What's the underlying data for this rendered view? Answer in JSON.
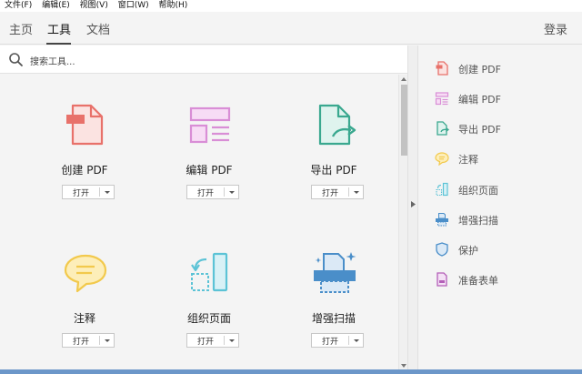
{
  "menu": [
    "文件(F)",
    "编辑(E)",
    "视图(V)",
    "窗口(W)",
    "帮助(H)"
  ],
  "tabs": [
    "主页",
    "工具",
    "文档"
  ],
  "login": "登录",
  "search": {
    "placeholder": "搜索工具..."
  },
  "tools": [
    {
      "name": "创建 PDF",
      "open": "打开"
    },
    {
      "name": "编辑 PDF",
      "open": "打开"
    },
    {
      "name": "导出 PDF",
      "open": "打开"
    },
    {
      "name": "注释",
      "open": "打开"
    },
    {
      "name": "组织页面",
      "open": "打开"
    },
    {
      "name": "增强扫描",
      "open": "打开"
    }
  ],
  "right_tools": [
    "创建 PDF",
    "编辑 PDF",
    "导出 PDF",
    "注释",
    "组织页面",
    "增强扫描",
    "保护",
    "准备表单"
  ],
  "colors": {
    "create": "#e8716a",
    "edit": "#d98ed6",
    "export": "#3aa88f",
    "comment": "#f2c94c",
    "organize": "#5cc3d6",
    "scan": "#4a8ec9",
    "protect": "#4a8ec9",
    "form": "#b45fb8"
  }
}
